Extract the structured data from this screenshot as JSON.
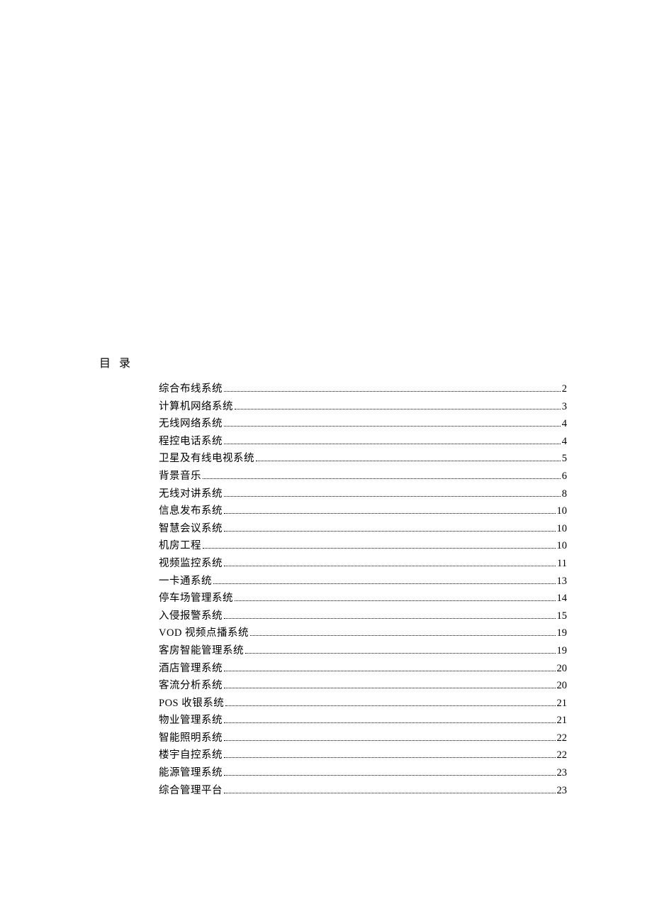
{
  "heading": "目 录",
  "entries": [
    {
      "title": "综合布线系统",
      "page": "2"
    },
    {
      "title": "计算机网络系统",
      "page": "3"
    },
    {
      "title": "无线网络系统",
      "page": "4"
    },
    {
      "title": "程控电话系统",
      "page": "4"
    },
    {
      "title": "卫星及有线电视系统",
      "page": "5"
    },
    {
      "title": "背景音乐",
      "page": "6"
    },
    {
      "title": "无线对讲系统",
      "page": "8"
    },
    {
      "title": "信息发布系统",
      "page": "10"
    },
    {
      "title": "智慧会议系统",
      "page": "10"
    },
    {
      "title": "机房工程",
      "page": "10"
    },
    {
      "title": "视频监控系统",
      "page": "11"
    },
    {
      "title": "一卡通系统",
      "page": "13"
    },
    {
      "title": "停车场管理系统",
      "page": "14"
    },
    {
      "title": "入侵报警系统",
      "page": "15"
    },
    {
      "title": "VOD 视频点播系统",
      "page": "19"
    },
    {
      "title": "客房智能管理系统",
      "page": "19"
    },
    {
      "title": "酒店管理系统",
      "page": "20"
    },
    {
      "title": "客流分析系统",
      "page": "20"
    },
    {
      "title": "POS 收银系统",
      "page": "21"
    },
    {
      "title": "物业管理系统",
      "page": "21"
    },
    {
      "title": "智能照明系统",
      "page": "22"
    },
    {
      "title": "楼宇自控系统",
      "page": "22"
    },
    {
      "title": "能源管理系统",
      "page": "23"
    },
    {
      "title": "综合管理平台",
      "page": "23"
    }
  ]
}
